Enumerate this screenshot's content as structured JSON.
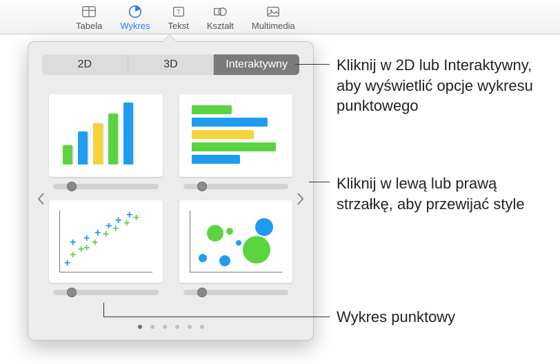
{
  "toolbar": {
    "items": [
      {
        "label": "Tabela"
      },
      {
        "label": "Wykres"
      },
      {
        "label": "Tekst"
      },
      {
        "label": "Kształt"
      },
      {
        "label": "Multimedia"
      }
    ]
  },
  "popover": {
    "tabs": {
      "t0": "2D",
      "t1": "3D",
      "t2": "Interaktywny"
    },
    "charts": [
      {
        "name": "column-chart-interactive"
      },
      {
        "name": "bar-chart-interactive"
      },
      {
        "name": "scatter-chart-interactive"
      },
      {
        "name": "bubble-chart-interactive"
      }
    ],
    "page_count": 6,
    "page_active": 0
  },
  "callouts": {
    "c1": "Kliknij w 2D lub Interaktywny, aby wyświetlić opcje wykresu punktowego",
    "c2": "Kliknij w lewą lub prawą strzałkę, aby przewijać style",
    "c3": "Wykres punktowy"
  },
  "colors": {
    "green": "#5bd442",
    "blue": "#1f9cf0",
    "yellow": "#f6d23b"
  }
}
